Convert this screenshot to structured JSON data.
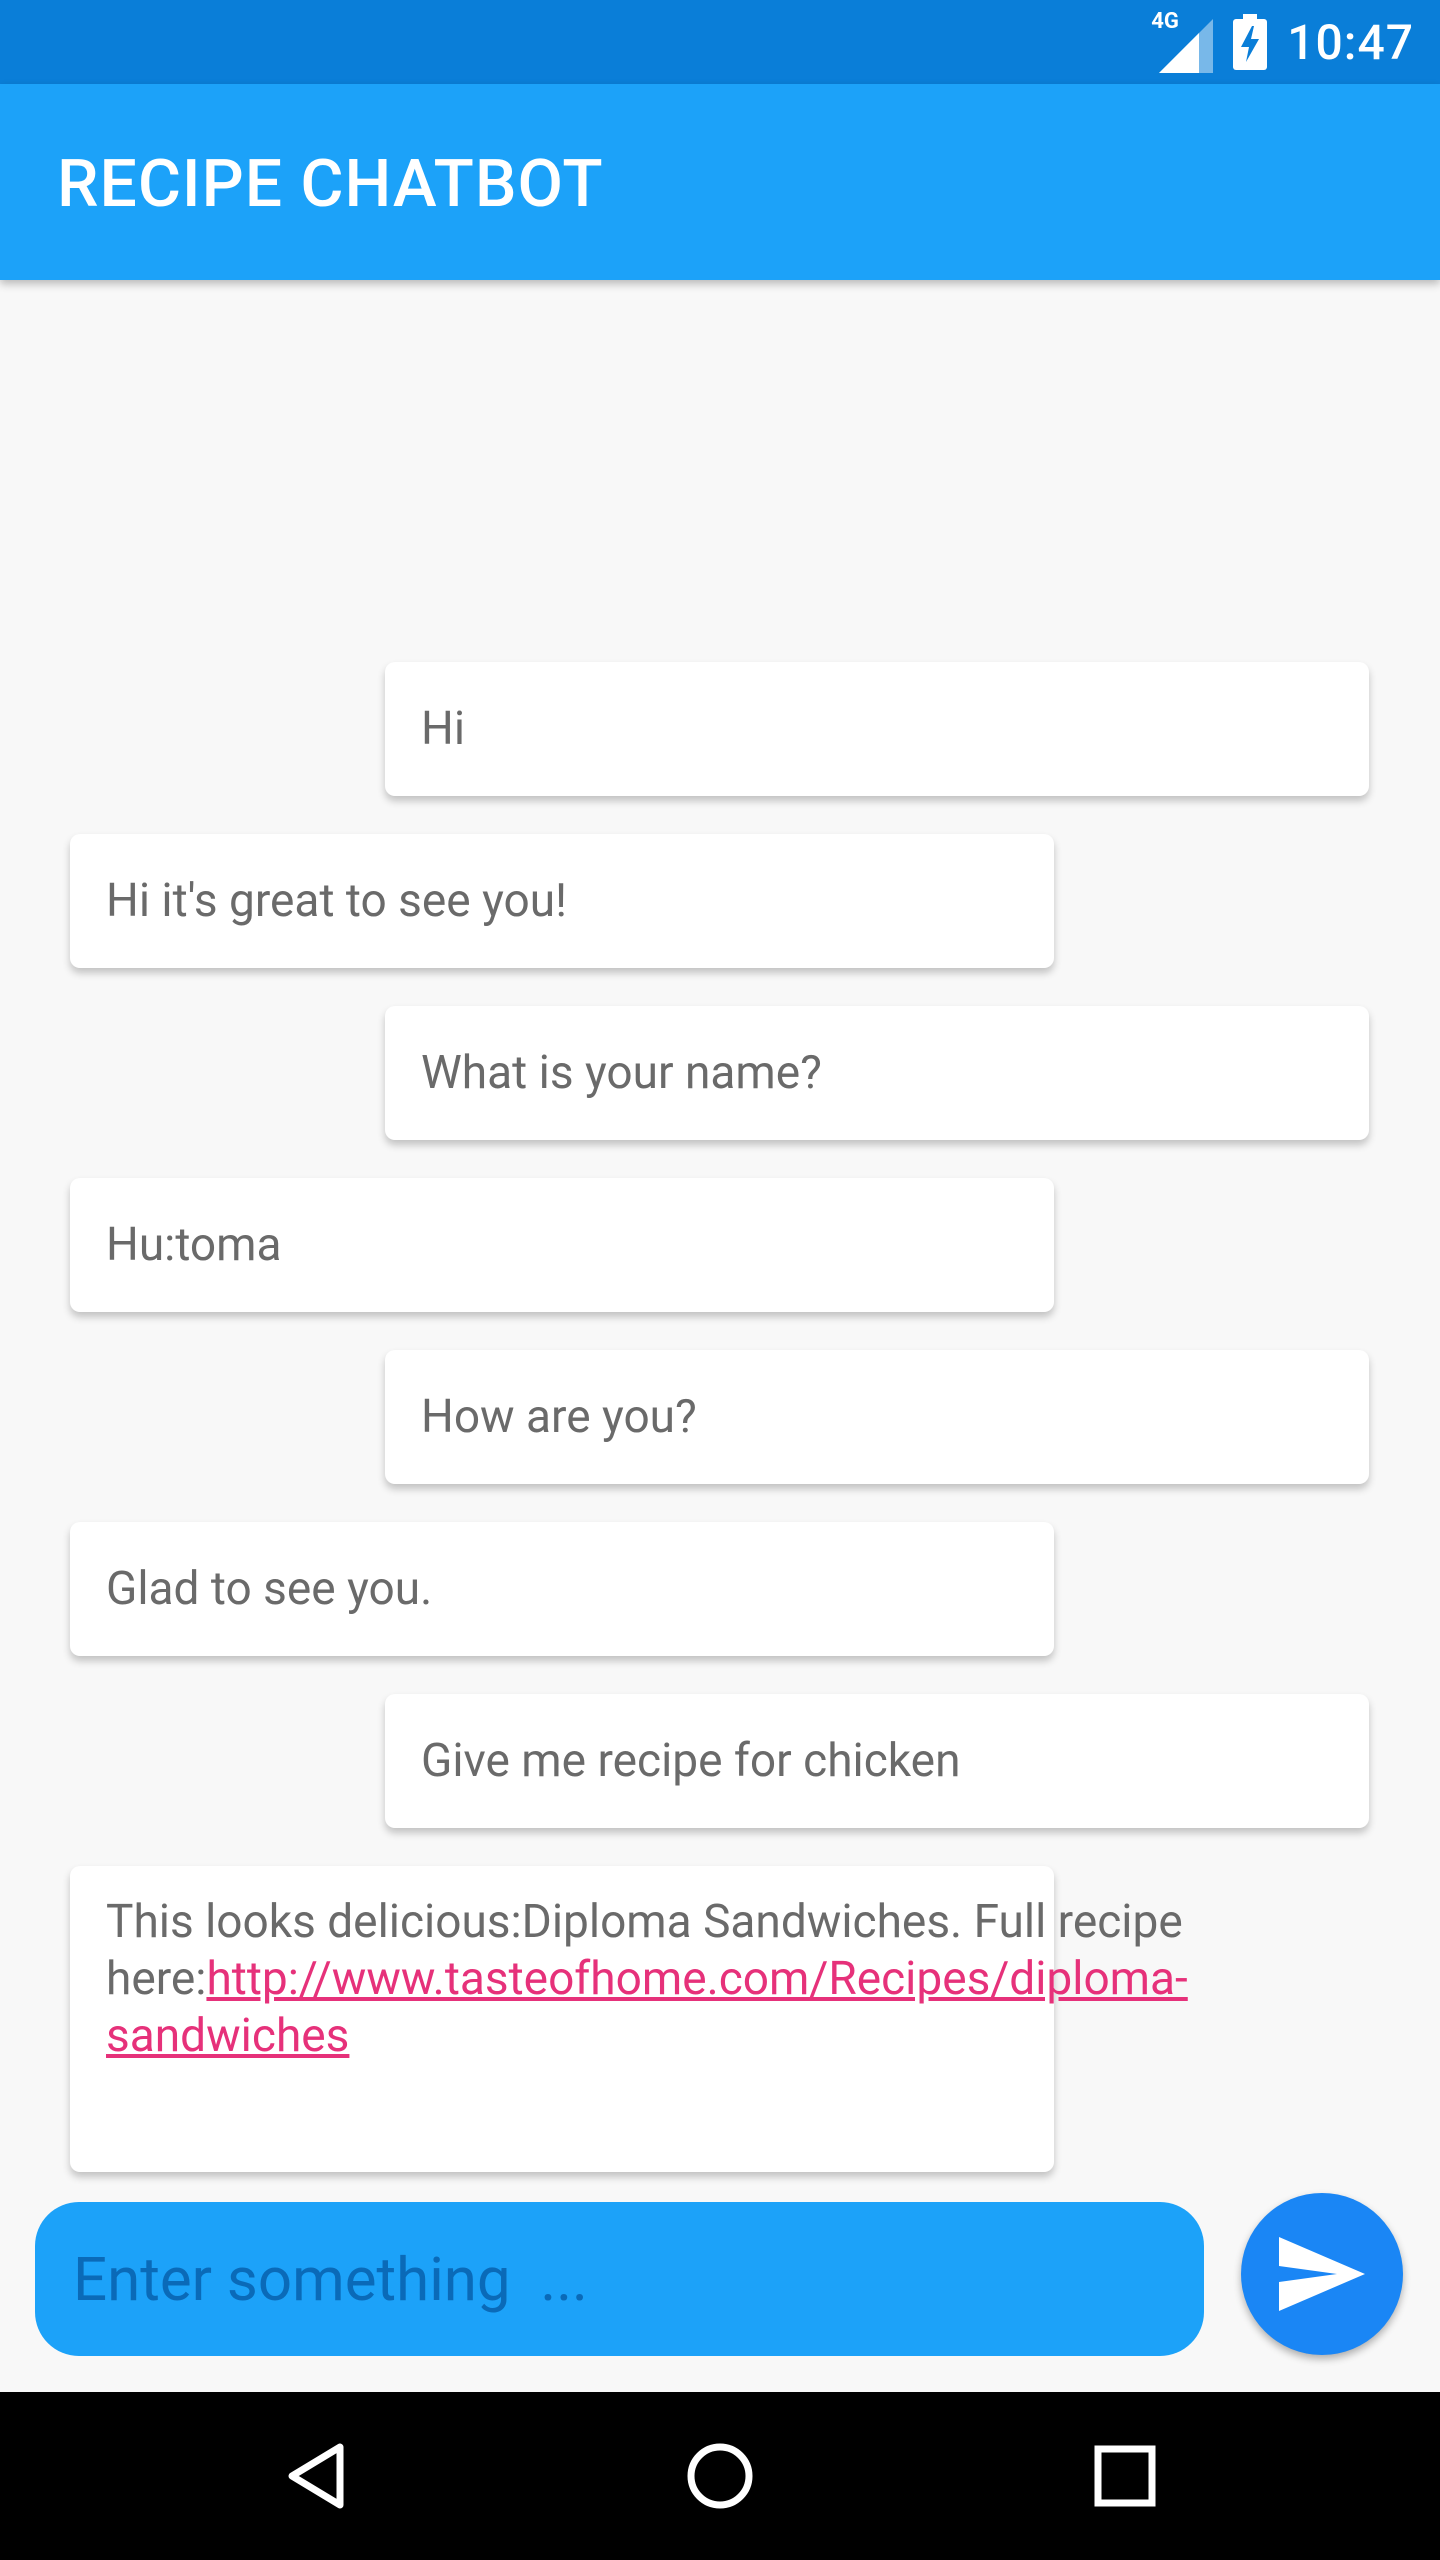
{
  "status_bar": {
    "time": "10:47",
    "network_label": "4G",
    "icons": [
      "signal-icon",
      "battery-charging-icon"
    ]
  },
  "app_bar": {
    "title": "RECIPE CHATBOT"
  },
  "messages": [
    {
      "sender": "user",
      "text": "Hi"
    },
    {
      "sender": "bot",
      "text": "Hi it's great to see you!"
    },
    {
      "sender": "user",
      "text": "What is your name?"
    },
    {
      "sender": "bot",
      "text": "Hu:toma"
    },
    {
      "sender": "user",
      "text": "How are you?"
    },
    {
      "sender": "bot",
      "text": "Glad to see you."
    },
    {
      "sender": "user",
      "text": "Give me recipe for chicken"
    },
    {
      "sender": "bot",
      "text": "This looks delicious:Diploma Sandwiches. Full recipe here:",
      "link": "http://www.tasteofhome.com/Recipes/diploma-sandwiches"
    }
  ],
  "input": {
    "placeholder": "Enter something  ...",
    "value": ""
  },
  "send_button": {
    "icon": "send-icon"
  },
  "nav_bar": {
    "back_icon": "back-icon",
    "home_icon": "home-icon",
    "recents_icon": "recents-icon"
  },
  "colors": {
    "status_bar": "#0A7ED8",
    "app_bar": "#1CA2F9",
    "link": "#E6317A",
    "send_button": "#1A86F5",
    "background": "#F8F8F8"
  }
}
